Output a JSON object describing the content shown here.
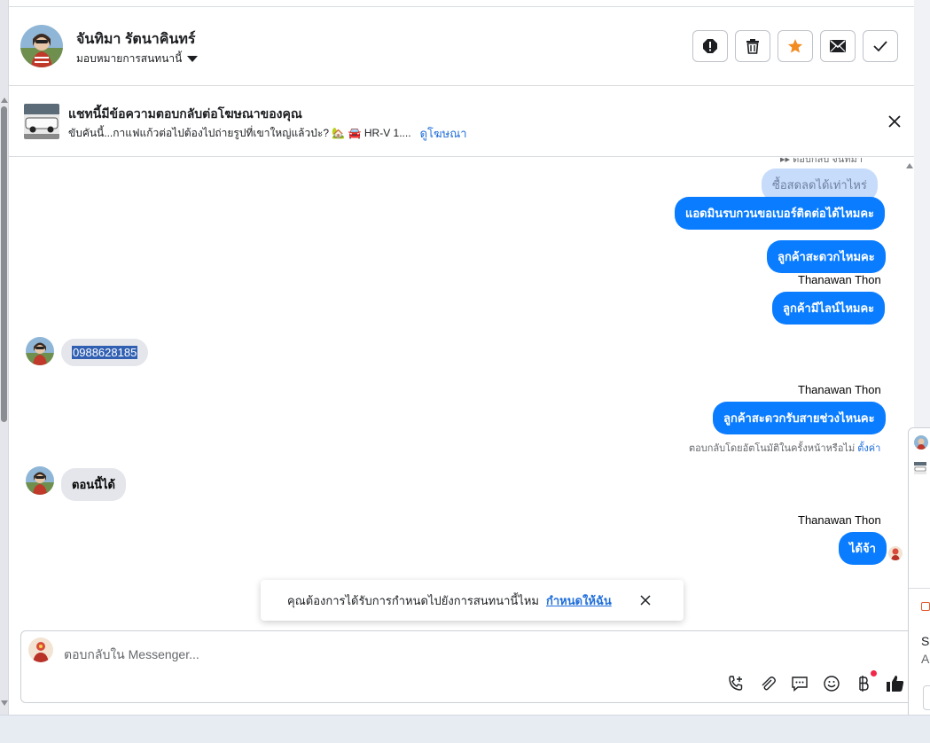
{
  "header": {
    "name": "จันทิมา รัตนาคินทร์",
    "assign_label": "มอบหมายการสนทนานี้",
    "actions": [
      "spam-icon",
      "trash-icon",
      "star-icon",
      "mail-icon",
      "check-icon"
    ]
  },
  "ad_banner": {
    "title": "แชทนี้มีข้อความตอบกลับต่อโฆษณาของคุณ",
    "subtitle": "ขับคันนี้...กาแฟแก้วต่อไปต้องไปถ่ายรูปที่เขาใหญ่แล้วป่ะ? 🏡 🚘 HR-V 1....",
    "link": "ดูโฆษณา"
  },
  "chat": {
    "partial_top": "▸▸ ตอบกลับ จันทิมา",
    "messages": [
      {
        "type": "out_faint",
        "text": "ซื้อสดลดได้เท่าไหร่"
      },
      {
        "type": "out",
        "text": "แอดมินรบกวนขอเบอร์ติดต่อได้ไหมคะ"
      },
      {
        "type": "out",
        "text": "ลูกค้าสะดวกไหมคะ"
      },
      {
        "type": "sender",
        "text": "Thanawan Thon"
      },
      {
        "type": "out",
        "text": "ลูกค้ามีไลน์ไหมคะ"
      },
      {
        "type": "in",
        "text": "0988628185"
      },
      {
        "type": "sender",
        "text": "Thanawan Thon"
      },
      {
        "type": "out",
        "text": "ลูกค้าสะดวกรับสายช่วงไหนคะ"
      },
      {
        "type": "note",
        "text": "ตอบกลับโดยอัตโนมัติในครั้งหน้าหรือไม่",
        "link": "ตั้งค่า"
      },
      {
        "type": "in",
        "text": "ตอนนี้ได้"
      },
      {
        "type": "sender",
        "text": "Thanawan Thon"
      },
      {
        "type": "out",
        "text": "ได้จ้า"
      }
    ]
  },
  "toast": {
    "text": "คุณต้องการได้รับการกำหนดไปยังการสนทนานี้ไหม",
    "link": "กำหนดให้ฉัน"
  },
  "composer": {
    "placeholder": "ตอบกลับใน Messenger..."
  },
  "right_panel": {
    "text1": "Se",
    "text2": "A"
  }
}
